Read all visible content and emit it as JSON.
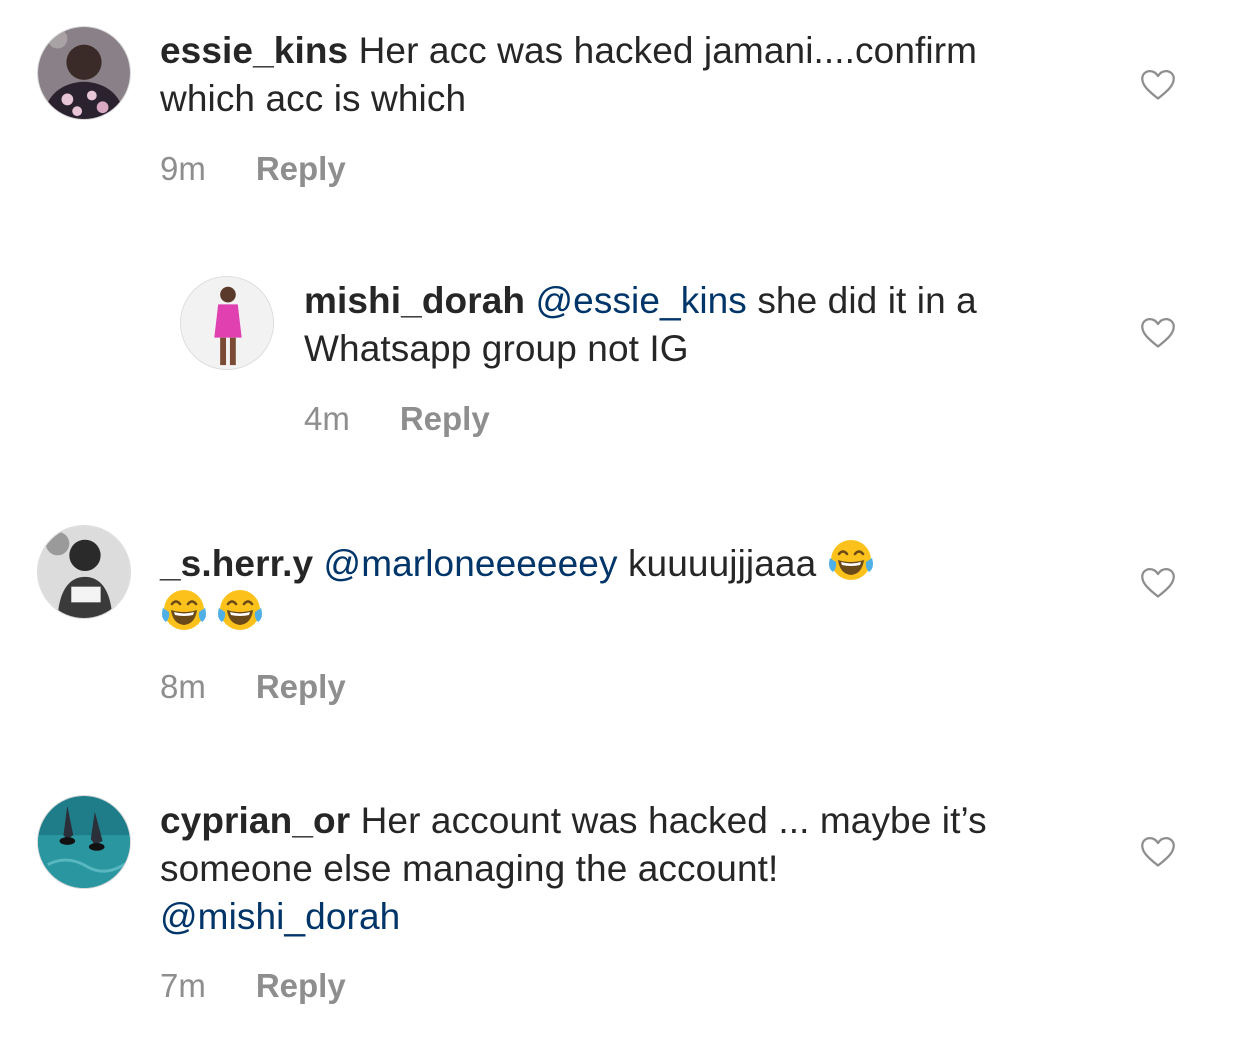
{
  "comments": [
    {
      "username": "essie_kins",
      "text": "Her acc was hacked jamani....confirm which acc is which",
      "time": "9m",
      "reply_label": "Reply",
      "avatar_icon": "user-avatar-essie"
    },
    {
      "username": "mishi_dorah",
      "mention": "@essie_kins",
      "text": "she did it in a Whatsapp group not IG",
      "time": "4m",
      "reply_label": "Reply",
      "avatar_icon": "user-avatar-mishi"
    },
    {
      "username": "_s.herr.y",
      "mention": "@marloneeeeeey",
      "text": "kuuuujjjaaa",
      "emojis": "😂 😂 😂",
      "time": "8m",
      "reply_label": "Reply",
      "avatar_icon": "user-avatar-sherry"
    },
    {
      "username": "cyprian_or",
      "text": "Her account was hacked ... maybe it’s someone else managing the account!",
      "mention": "@mishi_dorah",
      "time": "7m",
      "reply_label": "Reply",
      "avatar_icon": "user-avatar-cyprian"
    }
  ],
  "icons": {
    "like": "heart-outline-icon",
    "emoji": "face-with-tears-of-joy-icon"
  },
  "colors": {
    "text": "#262626",
    "mention": "#003569",
    "meta": "#8e8e8e",
    "heart": "#8e8e8e"
  }
}
